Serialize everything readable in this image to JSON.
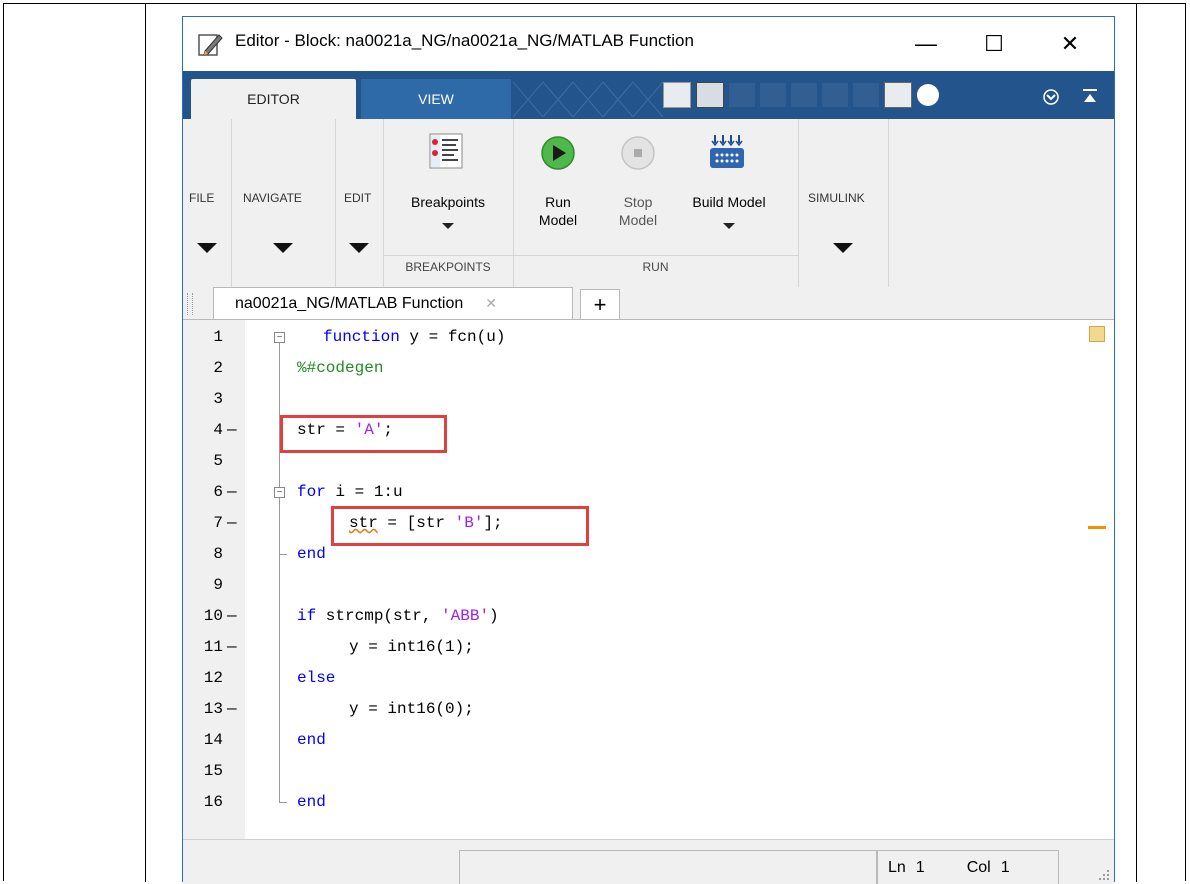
{
  "window": {
    "title": "Editor - Block: na0021a_NG/na0021a_NG/MATLAB Function",
    "minimize": "—",
    "maximize": "☐",
    "close": "✕"
  },
  "ribbon_tabs": {
    "editor": "EDITOR",
    "view": "VIEW"
  },
  "ribbon": {
    "file": "FILE",
    "navigate": "NAVIGATE",
    "edit": "EDIT",
    "breakpoints_btn": "Breakpoints",
    "breakpoints_group": "BREAKPOINTS",
    "run_model_1": "Run",
    "run_model_2": "Model",
    "stop_model_1": "Stop",
    "stop_model_2": "Model",
    "build_model": "Build Model",
    "run_group": "RUN",
    "simulink": "SIMULINK"
  },
  "doc_tab": {
    "label": "na0021a_NG/MATLAB Function",
    "close": "✕",
    "add": "+"
  },
  "code": {
    "lines": [
      {
        "n": "1",
        "dash": ""
      },
      {
        "n": "2",
        "dash": ""
      },
      {
        "n": "3",
        "dash": ""
      },
      {
        "n": "4",
        "dash": "—"
      },
      {
        "n": "5",
        "dash": ""
      },
      {
        "n": "6",
        "dash": "—"
      },
      {
        "n": "7",
        "dash": "—"
      },
      {
        "n": "8",
        "dash": ""
      },
      {
        "n": "9",
        "dash": ""
      },
      {
        "n": "10",
        "dash": "—"
      },
      {
        "n": "11",
        "dash": "—"
      },
      {
        "n": "12",
        "dash": ""
      },
      {
        "n": "13",
        "dash": "—"
      },
      {
        "n": "14",
        "dash": ""
      },
      {
        "n": "15",
        "dash": ""
      },
      {
        "n": "16",
        "dash": ""
      }
    ],
    "l1_kw": "function",
    "l1_rest": " y = fcn(u)",
    "l2": "%#codegen",
    "l4_a": "str = ",
    "l4_s": "'A'",
    "l4_b": ";",
    "l6_kw": "for",
    "l6_rest": " i = 1:u",
    "l7_a": "str",
    "l7_b": " = [str ",
    "l7_s": "'B'",
    "l7_c": "];",
    "l8": "end",
    "l10_a": "if",
    "l10_b": " strcmp(str, ",
    "l10_s": "'ABB'",
    "l10_c": ")",
    "l11": "y = int16(1);",
    "l12": "else",
    "l13": "y = int16(0);",
    "l14": "end",
    "l16": "end"
  },
  "status": {
    "ln_label": "Ln",
    "ln_val": "1",
    "col_label": "Col",
    "col_val": "1"
  },
  "colors": {
    "ribbon_tab_bg": "#23548c",
    "keyword": "#0000ff",
    "string": "#a020f0",
    "comment": "#228b22",
    "highlight": "#e04040"
  }
}
